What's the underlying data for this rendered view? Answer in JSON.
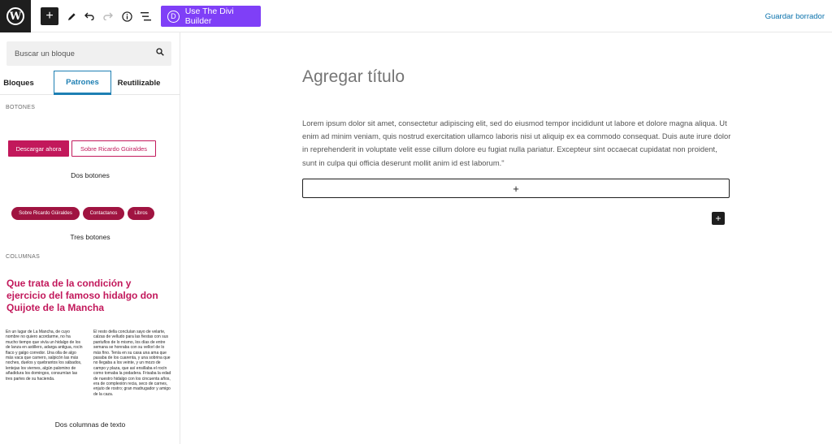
{
  "topbar": {
    "logo": "wordpress-icon",
    "icons": [
      "plus-icon",
      "pencil-icon",
      "undo-icon",
      "redo-icon",
      "info-icon",
      "list-view-icon"
    ],
    "divi_button": {
      "letter": "D",
      "label": "Use The Divi Builder",
      "color": "#7f3ff7"
    },
    "save_draft": "Guardar borrador"
  },
  "sidebar": {
    "search_placeholder": "Buscar un bloque",
    "tabs": [
      {
        "label": "Bloques",
        "active": false
      },
      {
        "label": "Patrones",
        "active": true
      },
      {
        "label": "Reutilizable",
        "active": false
      }
    ],
    "sections": {
      "botones": "BOTONES",
      "columnas": "COLUMNAS"
    },
    "patterns": {
      "two_buttons": {
        "primary": "Descargar ahora",
        "secondary": "Sobre Ricardo Güiraldes",
        "caption": "Dos botones"
      },
      "three_buttons": {
        "pills": [
          "Sobre Ricardo Güiraldes",
          "Contactanos",
          "Libros"
        ],
        "caption": "Tres botones"
      },
      "two_columns": {
        "title": "Que trata de la condición y ejercicio del famoso hidalgo don Quijote de la Mancha",
        "col1": "En un lugar de La Mancha, de cuyo nombre no quiero acordarme, no ha mucho tiempo que vivía un hidalgo de los de lanza en astillero, adarga antigua, rocín flaco y galgo corredor. Una olla de algo más vaca que carnero, salpicón las más noches, duelos y quebrantos los sábados, lentejas los viernes, algún palomino de añadidura los domingos, consumían las tres partes de su hacienda.",
        "col2": "El resto della concluían sayo de velarte, calzas de velludo para las fiestas con sus pantuflos de lo mismo, los días de entre semana se honraba con su vellorí de lo más fino. Tenía en su casa una ama que pasaba de los cuarenta, y una sobrina que no llegaba a los veinte, y un mozo de campo y plaza, que así ensillaba el rocín como tomaba la podadera. Frisaba la edad de nuestro hidalgo con los cincuenta años, era de complexión recia, seco de carnes, enjuto de rostro; gran madrugador y amigo de la caza.",
        "caption": "Dos columnas de texto"
      }
    },
    "accent": "#c2185b"
  },
  "editor": {
    "title_placeholder": "Agregar título",
    "paragraph": "Lorem ipsum dolor sit amet, consectetur adipiscing elit, sed do eiusmod tempor incididunt ut labore et dolore magna aliqua. Ut enim ad minim veniam, quis nostrud exercitation ullamco laboris nisi ut aliquip ex ea commodo consequat. Duis aute irure dolor in reprehenderit in voluptate velit esse cillum dolore eu fugiat nulla pariatur. Excepteur sint occaecat cupidatat non proident, sunt in culpa qui officia deserunt mollit anim id est laborum.\"",
    "appender_symbol": "+",
    "inserter_symbol": "+"
  }
}
